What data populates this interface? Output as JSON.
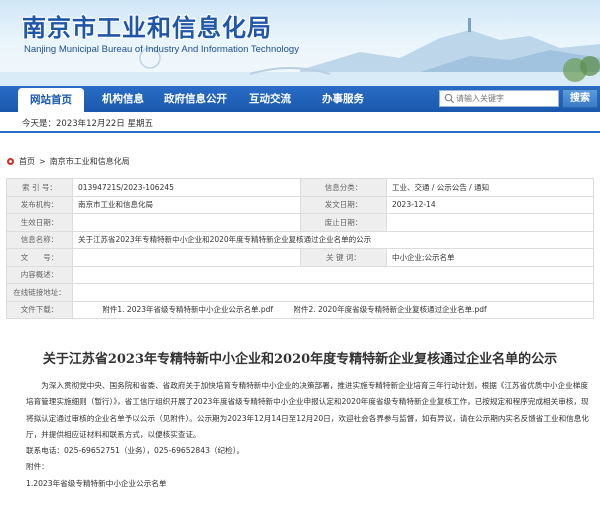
{
  "header": {
    "title": "南京市工业和信息化局",
    "subtitle": "Nanjing Municipal Bureau of Industry And Information Technology"
  },
  "nav": {
    "items": [
      "网站首页",
      "机构信息",
      "政府信息公开",
      "互动交流",
      "办事服务"
    ],
    "search_placeholder": "请输入关键字",
    "search_button": "搜索"
  },
  "date_text": "今天是：2023年12月22日  星期五",
  "breadcrumb": {
    "home": "首页",
    "current": "南京市工业和信息化局"
  },
  "info": {
    "labels": {
      "index": "索 引 号：",
      "category": "信息分类：",
      "issuer": "发布机构：",
      "pub_date": "发文日期：",
      "effective": "生效日期：",
      "expire": "废止日期：",
      "name": "信息名称：",
      "doc_no": "文　　号：",
      "keywords": "关 键 词：",
      "overview": "内容概述：",
      "basis": "在线链接地址：",
      "attachments": "文件下载："
    },
    "values": {
      "index": "01394721S/2023-106245",
      "category": "工业、交通 / 公示公告 / 通知",
      "issuer": "南京市工业和信息化局",
      "pub_date": "2023-12-14",
      "effective": "",
      "expire": "",
      "name": "关于江苏省2023年专精特新中小企业和2020年度专精特新企业复核通过企业名单的公示",
      "doc_no": "",
      "keywords": "中小企业;公示名单",
      "overview": "",
      "basis": ""
    },
    "attachments": [
      "附件1. 2023年省级专精特新中小企业公示名单.pdf",
      "附件2. 2020年度省级专精特新企业复核通过企业名单.pdf"
    ]
  },
  "article": {
    "title": "关于江苏省2023年专精特新中小企业和2020年度专精特新企业复核通过企业名单的公示",
    "paragraphs": [
      "为深入贯彻党中央、国务院和省委、省政府关于加快培育专精特新中小企业的决策部署，推进实施专精特新企业培育三年行动计划，根据《江苏省优质中小企业梯度培育管理实施细则（暂行）》，省工信厅组织开展了2023年度省级专精特新中小企业申报认定和2020年度省级专精特新企业复核工作，已按规定和程序完成相关审核，现将拟认定通过审核的企业名单予以公示（见附件）。公示期为2023年12月14日至12月20日，欢迎社会各界参与监督，如有异议，请在公示期内实名反馈省工业和信息化厅，并提供相应证材料和联系方式，以便核实查证。",
      "联系电话：025-69652751（业务），025-69652843（纪检）。",
      "附件：",
      "1.2023年省级专精特新中小企业公示名单"
    ]
  },
  "colors": {
    "brand_blue": "#1958ad",
    "title_blue": "#1f56a8"
  }
}
